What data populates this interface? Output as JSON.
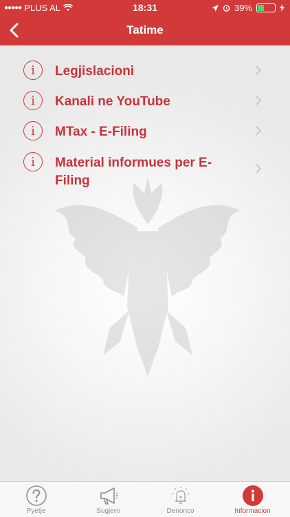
{
  "status_bar": {
    "carrier": "PLUS AL",
    "time": "18:31",
    "battery": "39%",
    "battery_level": 0.39
  },
  "nav": {
    "title": "Tatime"
  },
  "list": {
    "items": [
      {
        "label": "Legjislacioni"
      },
      {
        "label": "Kanali ne YouTube"
      },
      {
        "label": "MTax - E-Filing"
      },
      {
        "label": "Material informues per E-Filing"
      }
    ]
  },
  "tabs": [
    {
      "label": "Pyetje",
      "icon": "question-icon"
    },
    {
      "label": "Sugjero",
      "icon": "megaphone-icon"
    },
    {
      "label": "Denonco",
      "icon": "bell-alert-icon"
    },
    {
      "label": "Informacion",
      "icon": "info-icon",
      "active": true
    }
  ],
  "colors": {
    "accent": "#d23a3a",
    "inactive": "#8f8f8f"
  }
}
